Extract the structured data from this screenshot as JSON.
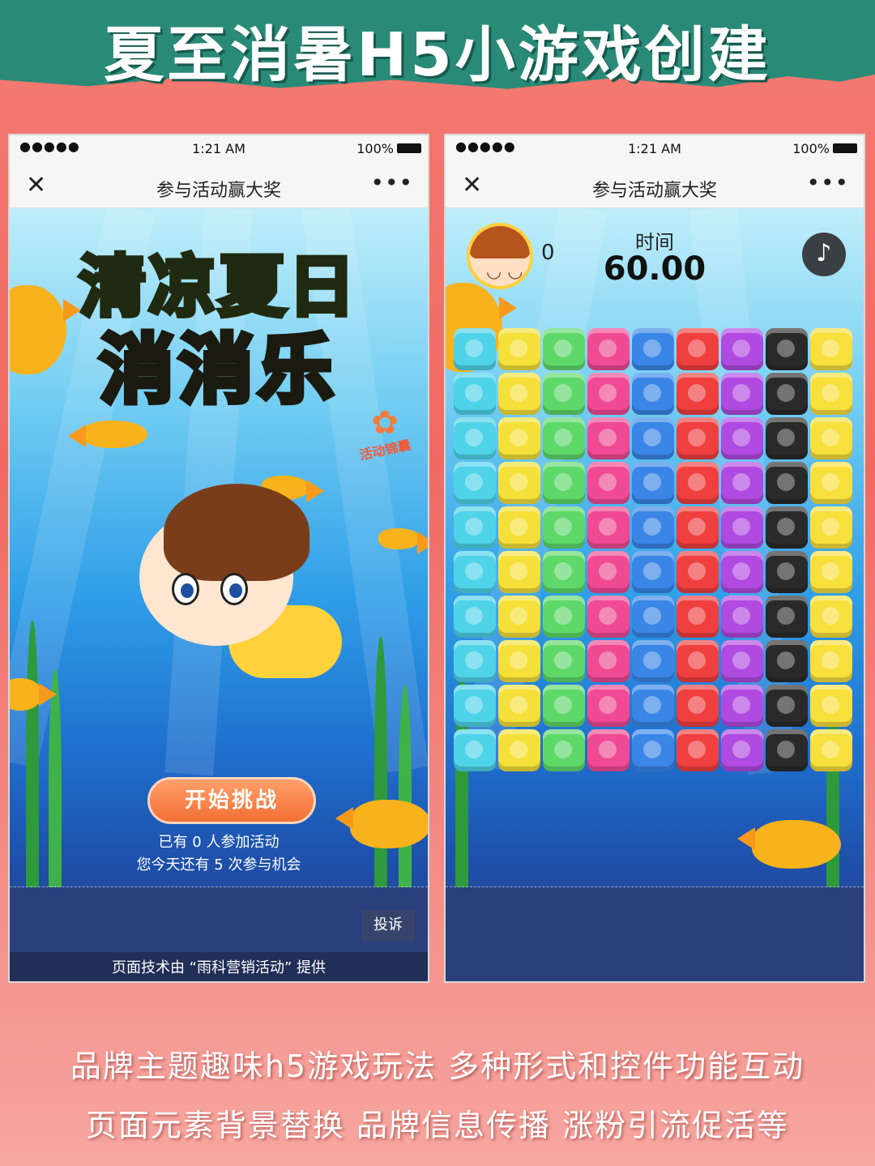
{
  "banner": {
    "title": "夏至消暑H5小游戏创建"
  },
  "phone_left": {
    "status": {
      "signal": "●●●●●",
      "time": "1:21 AM",
      "battery": "100%"
    },
    "nav": {
      "close": "✕",
      "title": "参与活动赢大奖",
      "more": "•••"
    },
    "game_title_line1": "清凉夏日",
    "game_title_line2": "消消乐",
    "badge_label": "活动锦囊",
    "start_button": "开始挑战",
    "participants_text": "已有 0 人参加活动",
    "chances_text": "您今天还有 5 次参与机会",
    "complain_button": "投诉",
    "credit_text": "页面技术由 “雨科营销活动” 提供"
  },
  "phone_right": {
    "status": {
      "signal": "●●●●●",
      "time": "1:21 AM",
      "battery": "100%"
    },
    "nav": {
      "close": "✕",
      "title": "参与活动赢大奖",
      "more": "•••"
    },
    "score": "0",
    "timer_label": "时间",
    "timer_value": "60.00",
    "music_icon": "♪",
    "board": {
      "rows": 10,
      "column_colors": [
        "#4fd3e8",
        "#f5e03a",
        "#5fd86a",
        "#ef4a93",
        "#3a86e6",
        "#ef3f3f",
        "#b04ae0",
        "#2a2a2a",
        "#f7df3c"
      ],
      "tile_names": [
        "dolphin",
        "pineapple",
        "leaf",
        "peach",
        "wave",
        "shrimp",
        "sprout",
        "bomb",
        "melon"
      ]
    }
  },
  "captions": {
    "line1": "品牌主题趣味h5游戏玩法  多种形式和控件功能互动",
    "line2": "页面元素背景替换  品牌信息传播  涨粉引流促活等"
  },
  "colors": {
    "banner": "#2a8a78",
    "background": "#f47b72",
    "start_button": "#f26f34"
  }
}
